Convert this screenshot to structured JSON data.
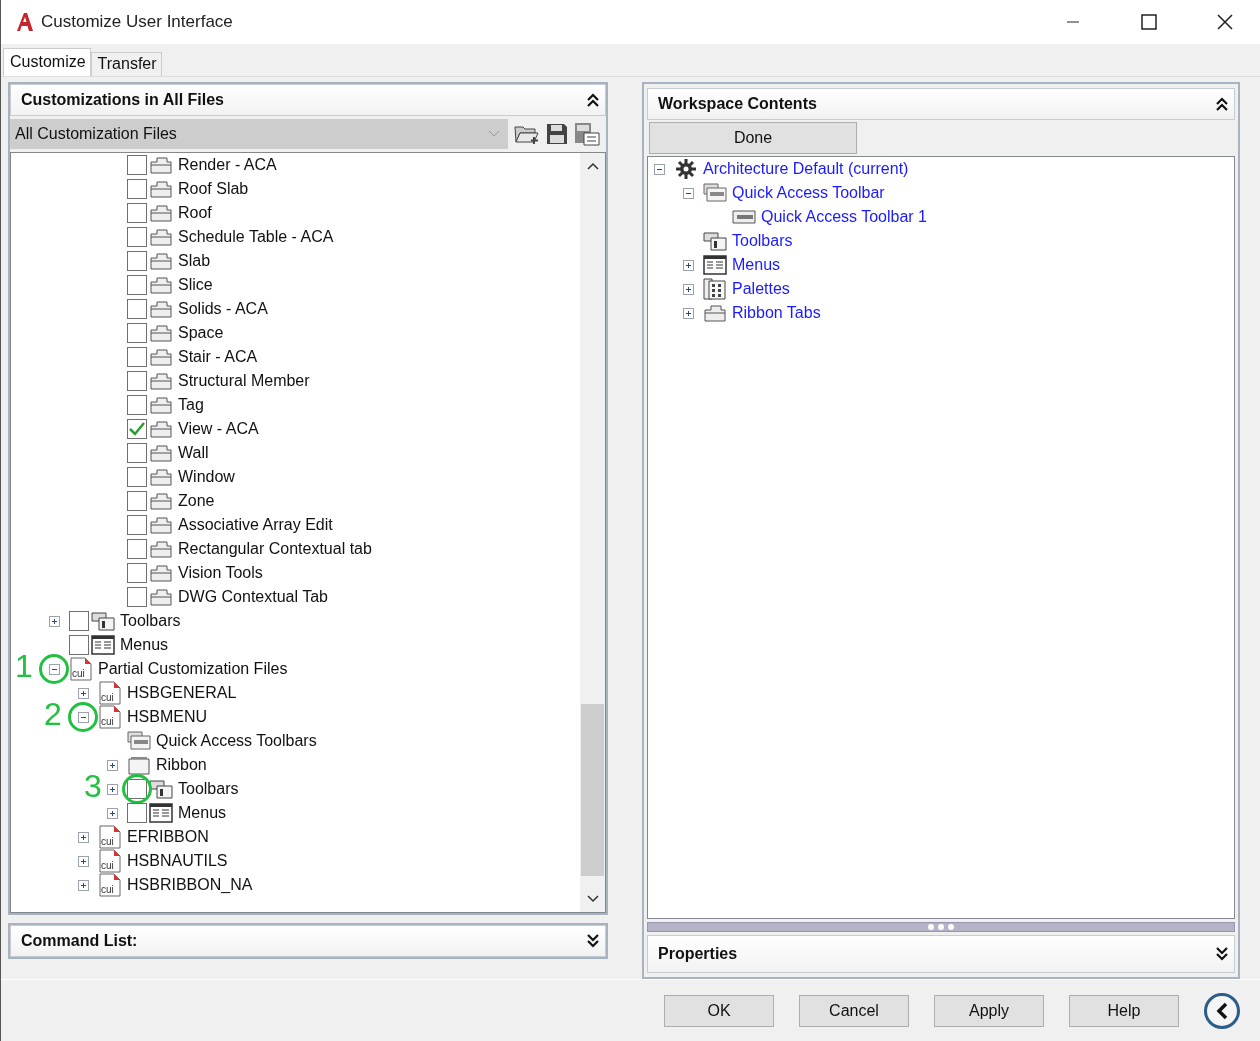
{
  "window": {
    "title": "Customize User Interface"
  },
  "tabs": [
    {
      "label": "Customize",
      "selected": true
    },
    {
      "label": "Transfer",
      "selected": false
    }
  ],
  "customizations": {
    "title": "Customizations in All Files",
    "file_select": {
      "value": "All Customization Files"
    },
    "tree": {
      "continued_rows": [
        {
          "label": "Render - ACA",
          "kind": "ribbon-tab",
          "checked": false
        },
        {
          "label": "Roof Slab",
          "kind": "ribbon-tab",
          "checked": false
        },
        {
          "label": "Roof",
          "kind": "ribbon-tab",
          "checked": false
        },
        {
          "label": "Schedule Table - ACA",
          "kind": "ribbon-tab",
          "checked": false
        },
        {
          "label": "Slab",
          "kind": "ribbon-tab",
          "checked": false
        },
        {
          "label": "Slice",
          "kind": "ribbon-tab",
          "checked": false
        },
        {
          "label": "Solids - ACA",
          "kind": "ribbon-tab",
          "checked": false
        },
        {
          "label": "Space",
          "kind": "ribbon-tab",
          "checked": false
        },
        {
          "label": "Stair - ACA",
          "kind": "ribbon-tab",
          "checked": false
        },
        {
          "label": "Structural Member",
          "kind": "ribbon-tab",
          "checked": false
        },
        {
          "label": "Tag",
          "kind": "ribbon-tab",
          "checked": false
        },
        {
          "label": "View - ACA",
          "kind": "ribbon-tab",
          "checked": true
        },
        {
          "label": "Wall",
          "kind": "ribbon-tab",
          "checked": false
        },
        {
          "label": "Window",
          "kind": "ribbon-tab",
          "checked": false
        },
        {
          "label": "Zone",
          "kind": "ribbon-tab",
          "checked": false
        },
        {
          "label": "Associative Array Edit",
          "kind": "ribbon-tab",
          "checked": false
        },
        {
          "label": "Rectangular Contextual tab",
          "kind": "ribbon-tab",
          "checked": false
        },
        {
          "label": "Vision Tools",
          "kind": "ribbon-tab",
          "checked": false
        },
        {
          "label": "DWG Contextual Tab",
          "kind": "ribbon-tab",
          "checked": false
        }
      ],
      "items": [
        {
          "label": "Toolbars",
          "kind": "toolbars",
          "expanded": false,
          "checked": false
        },
        {
          "label": "Menus",
          "kind": "menus",
          "checked": false
        },
        {
          "label": "Partial Customization Files",
          "kind": "cui",
          "expanded": true,
          "toggle_annotation": "1",
          "children": [
            {
              "label": "HSBGENERAL",
              "kind": "cui",
              "expanded": false
            },
            {
              "label": "HSBMENU",
              "kind": "cui",
              "expanded": true,
              "toggle_annotation": "2",
              "children": [
                {
                  "label": "Quick Access Toolbars",
                  "kind": "qat"
                },
                {
                  "label": "Ribbon",
                  "kind": "ribbon",
                  "expanded": false
                },
                {
                  "label": "Toolbars",
                  "kind": "toolbars",
                  "expanded": false,
                  "checked": false,
                  "checkbox_annotation": "3"
                },
                {
                  "label": "Menus",
                  "kind": "menus",
                  "expanded": false,
                  "checked": false
                }
              ]
            },
            {
              "label": "EFRIBBON",
              "kind": "cui",
              "expanded": false
            },
            {
              "label": "HSBNAUTILS",
              "kind": "cui",
              "expanded": false
            },
            {
              "label": "HSBRIBBON_NA",
              "kind": "cui",
              "expanded": false
            }
          ]
        }
      ]
    }
  },
  "command_list": {
    "title": "Command List:"
  },
  "workspace": {
    "title": "Workspace Contents",
    "done_button": "Done",
    "tree": [
      {
        "label": "Architecture Default (current)",
        "kind": "gear",
        "expanded": true,
        "children": [
          {
            "label": "Quick Access Toolbar",
            "kind": "qat",
            "expanded": true,
            "children": [
              {
                "label": "Quick Access Toolbar 1",
                "kind": "toolbar"
              }
            ]
          },
          {
            "label": "Toolbars",
            "kind": "toolbars"
          },
          {
            "label": "Menus",
            "kind": "menus",
            "expanded": false
          },
          {
            "label": "Palettes",
            "kind": "palettes",
            "expanded": false
          },
          {
            "label": "Ribbon Tabs",
            "kind": "ribbon-tab",
            "expanded": false
          }
        ]
      }
    ]
  },
  "properties": {
    "title": "Properties"
  },
  "buttons": [
    "OK",
    "Cancel",
    "Apply",
    "Help"
  ]
}
